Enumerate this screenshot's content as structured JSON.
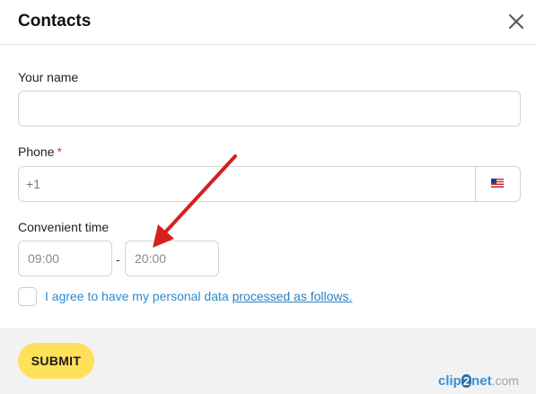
{
  "dialog": {
    "title": "Contacts",
    "close_icon": "close-icon"
  },
  "form": {
    "name": {
      "label": "Your name",
      "value": "",
      "placeholder": ""
    },
    "phone": {
      "label": "Phone",
      "required_mark": "*",
      "value": "",
      "placeholder": "+1",
      "country_flag_icon": "us-flag-icon"
    },
    "time": {
      "label": "Convenient time",
      "from_placeholder": "09:00",
      "separator": "-",
      "to_placeholder": "20:00"
    },
    "consent": {
      "checked": false,
      "text": "I agree to have my personal data ",
      "link_text": "processed as follows."
    },
    "submit_label": "SUBMIT"
  },
  "annotation": {
    "arrow_color": "#d42020"
  },
  "watermark": {
    "part1": "clip",
    "part2": "2",
    "part3": "net",
    "part4": ".com"
  },
  "colors": {
    "submit_bg": "#ffe05a",
    "link": "#2a7fc0",
    "required": "#e53935",
    "footer_bg": "#f2f2f2"
  }
}
